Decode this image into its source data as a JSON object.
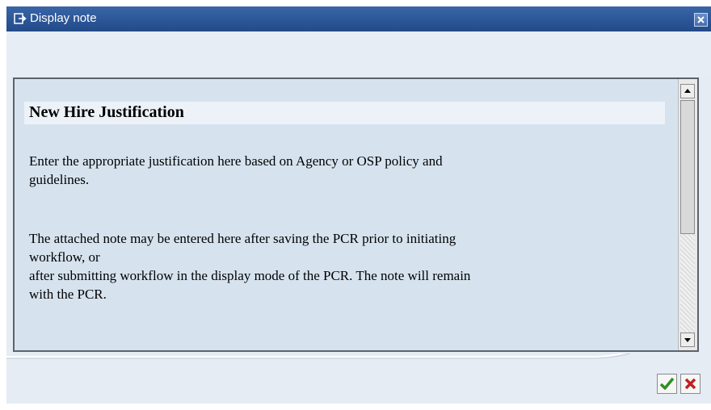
{
  "window": {
    "title": "Display note",
    "title_icon": "display-note-icon",
    "close_icon": "close-icon"
  },
  "note": {
    "heading": "New Hire Justification",
    "paragraph1_line1": "Enter the appropriate justification here based on Agency or OSP policy and",
    "paragraph1_line2": "guidelines.",
    "paragraph2_line1": "The attached note may be entered here after saving the PCR prior to initiating",
    "paragraph2_line2": "workflow, or",
    "paragraph2_line3": "after submitting workflow in the display mode of the PCR.  The note will remain",
    "paragraph2_line4": "with the PCR."
  },
  "scrollbar": {
    "up_icon": "scroll-up-arrow-icon",
    "down_icon": "scroll-down-arrow-icon"
  },
  "footer": {
    "ok_icon": "checkmark-icon",
    "cancel_icon": "cancel-x-icon"
  },
  "colors": {
    "titlebar": "#2a5495",
    "text_background": "#d6e3ef",
    "dialog_background": "#e6ecf4",
    "ok_green": "#2f8f1f",
    "cancel_red": "#c02020"
  }
}
